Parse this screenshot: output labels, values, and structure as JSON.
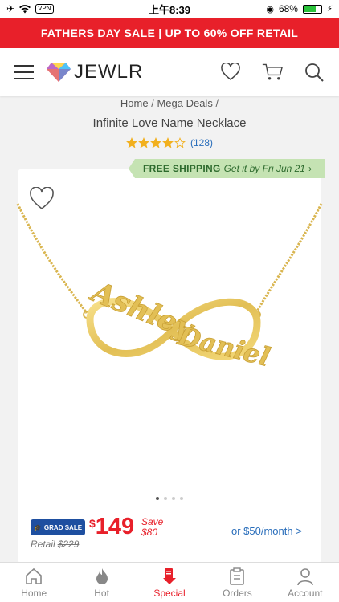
{
  "status": {
    "time": "上午8:39",
    "vpn": "VPN",
    "battery": "68%",
    "battery_level": 0.68
  },
  "promo": {
    "text": "FATHERS DAY SALE | UP TO 60% OFF RETAIL"
  },
  "header": {
    "logo": "JEWLR"
  },
  "breadcrumb": {
    "home": "Home",
    "sep1": " / ",
    "mega": "Mega Deals",
    "sep2": " /"
  },
  "product": {
    "title": "Infinite Love Name Necklace",
    "rating": 4,
    "review_count": "(128)",
    "name1": "Ashley",
    "name2": "Daniel"
  },
  "shipping": {
    "label": "FREE SHIPPING",
    "date": "Get it by Fri Jun 21",
    "chevron": "›"
  },
  "pricing": {
    "badge": "GRAD SALE",
    "currency": "$",
    "price": "149",
    "save_label": "Save",
    "save_amount": "$80",
    "retail_label": "Retail",
    "retail_price": "$229",
    "monthly": "or $50/month >"
  },
  "tabs": [
    {
      "label": "Home"
    },
    {
      "label": "Hot"
    },
    {
      "label": "Special"
    },
    {
      "label": "Orders"
    },
    {
      "label": "Account"
    }
  ],
  "colors": {
    "brand_red": "#e8202a",
    "link_blue": "#2a6ebb",
    "gold": "#e8c766"
  }
}
